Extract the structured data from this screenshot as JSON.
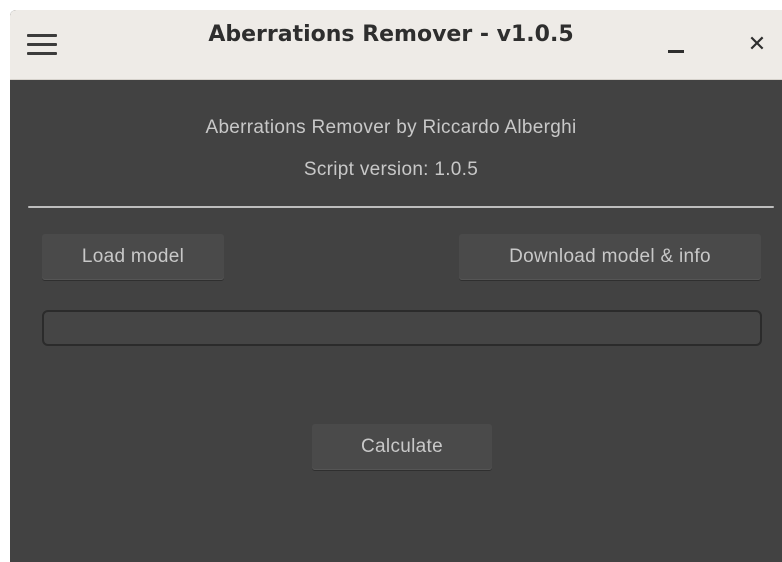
{
  "window": {
    "title": "Aberrations Remover - v1.0.5",
    "minimize_label": "–",
    "close_label": "✕"
  },
  "header": {
    "author_line": "Aberrations Remover by Riccardo Alberghi",
    "version_line": "Script version: 1.0.5"
  },
  "buttons": {
    "load_model": "Load model",
    "download_model": "Download model & info",
    "calculate": "Calculate"
  },
  "progress": {
    "value": 0
  },
  "icons": {
    "menu": "hamburger-menu-icon",
    "minimize": "minimize-icon",
    "close": "close-icon"
  },
  "colors": {
    "window_background": "#424242",
    "titlebar_background": "#eeebe7",
    "text": "#c8c8c8"
  }
}
